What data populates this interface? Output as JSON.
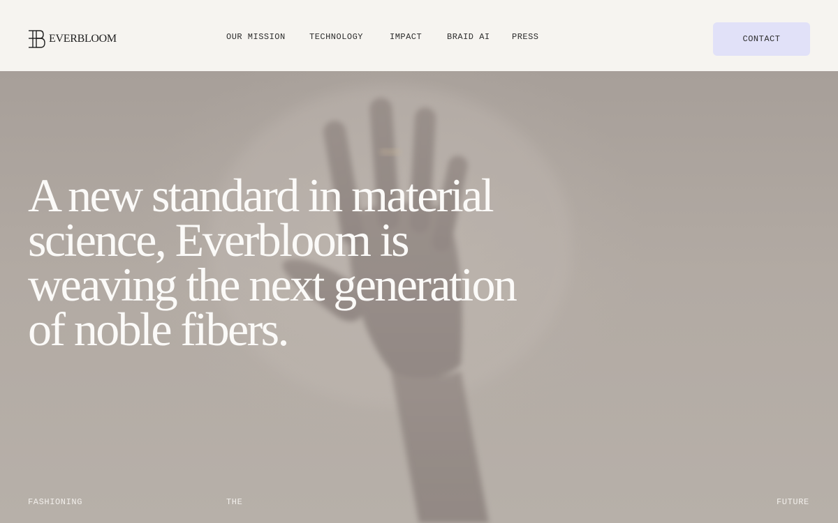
{
  "brand": {
    "name": "EVERBLOOM",
    "logo_icon": "eb-monogram-icon"
  },
  "nav": {
    "items": [
      {
        "label": "OUR MISSION"
      },
      {
        "label": "TECHNOLOGY"
      },
      {
        "label": "IMPACT"
      },
      {
        "label": "BRAID AI"
      },
      {
        "label": "PRESS"
      }
    ],
    "contact_label": "CONTACT"
  },
  "hero": {
    "headline_lines": [
      "A new standard in material",
      "science, Everbloom is",
      "weaving the next generation",
      "of noble fibers."
    ],
    "tagline": [
      "FASHIONING",
      "THE",
      "FUTURE"
    ]
  },
  "colors": {
    "header_bg": "#f6f4f0",
    "contact_bg": "#e1e1f8",
    "hero_bg": "#b0a8a1",
    "text_dark": "#2b2b2b",
    "text_light": "#fbfaf8"
  }
}
